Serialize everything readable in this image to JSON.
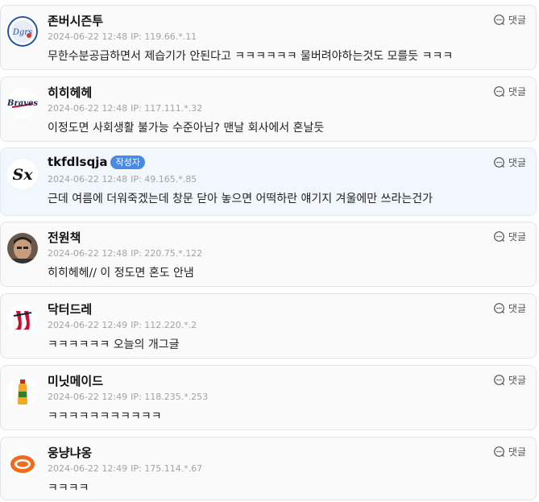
{
  "comments": [
    {
      "nickname": "존버시즌투",
      "date": "2024-06-22 12:48",
      "ip": "IP: 119.66.*.11",
      "text": "무한수분공급하면서 제습기가 안된다고 ㅋㅋㅋㅋㅋㅋ 물버려야하는것도 모를듯 ㅋㅋㅋ",
      "reply_label": "댓글",
      "avatar_icon": "dodgers-logo-icon"
    },
    {
      "nickname": "히히헤헤",
      "date": "2024-06-22 12:48",
      "ip": "IP: 117.111.*.32",
      "text": "이정도면 사회생활 불가능 수준아님? 맨날 회사에서 혼날듯",
      "reply_label": "댓글",
      "avatar_icon": "braves-logo-icon"
    },
    {
      "nickname": "tkfdlsqja",
      "badge": "작성자",
      "date": "2024-06-22 12:48",
      "ip": "IP: 49.165.*.85",
      "text": "근데 여름에 더워죽겠는데 창문 닫아 놓으면 어떡하란 얘기지 겨울에만 쓰라는건가",
      "reply_label": "댓글",
      "avatar_icon": "white-sox-logo-icon"
    },
    {
      "nickname": "전원책",
      "date": "2024-06-22 12:48",
      "ip": "IP: 220.75.*.122",
      "text": "히히헤헤// 이 정도면 혼도 안냄",
      "reply_label": "댓글",
      "avatar_icon": "person-photo-icon"
    },
    {
      "nickname": "닥터드레",
      "date": "2024-06-22 12:49",
      "ip": "IP: 112.220.*.2",
      "text": "ㅋㅋㅋㅋㅋㅋ 오늘의 개그글",
      "reply_label": "댓글",
      "avatar_icon": "red-sox-logo-icon"
    },
    {
      "nickname": "미닛메이드",
      "date": "2024-06-22 12:49",
      "ip": "IP: 118.235.*.253",
      "text": "ㅋㅋㅋㅋㅋㅋㅋㅋㅋㅋㅋ",
      "reply_label": "댓글",
      "avatar_icon": "juice-bottle-icon"
    },
    {
      "nickname": "웅냥냐옹",
      "date": "2024-06-22 12:49",
      "ip": "IP: 175.114.*.67",
      "text": "ㅋㅋㅋㅋ",
      "reply_label": "댓글",
      "avatar_icon": "orange-logo-icon"
    }
  ],
  "colors": {
    "author_bg": "#f1f7fc",
    "badge_bg": "#4a8be0",
    "card_bg": "#fafafa"
  }
}
